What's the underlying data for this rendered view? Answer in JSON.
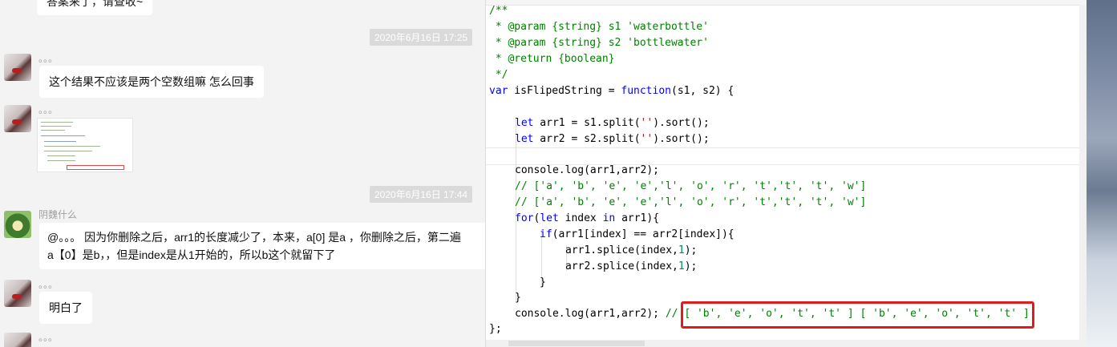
{
  "chat": {
    "top_bubble_partial": "答案来了，请查收~",
    "ts1": "2020年6月16日 17:25",
    "ts2": "2020年6月16日 17:44",
    "dots": "。。。",
    "msg1": "这个结果不应该是两个空数组嘛 怎么回事",
    "nick_yinhei": "阴魏什么",
    "msg2_line1": "@。。。 因为你删除之后，arr1的长度减少了，本来，a[0] 是a ，你删除之后，第二遍",
    "msg2_line2": "a【0】是b，，但是index是从1开始的，所以b这个就留下了",
    "msg3": "明白了"
  },
  "code": {
    "l1": "/**",
    "l2": " * @param {string} s1 'waterbottle'",
    "l3": " * @param {string} s2 'bottlewater'",
    "l4": " * @return {boolean}",
    "l5": " */",
    "l6_kw": "var",
    "l6_mid": " isFlipedString = ",
    "l6_fn": "function",
    "l6_end": "(s1, s2) {",
    "l8_kw": "let",
    "l8_a": " arr1 = s1.split(",
    "l8_s": "''",
    "l8_b": ").sort();",
    "l9_kw": "let",
    "l9_a": " arr2 = s2.split(",
    "l9_s": "''",
    "l9_b": ").sort();",
    "l11": "console.log(arr1,arr2);",
    "l12": "// ['a', 'b', 'e', 'e','l', 'o', 'r', 't','t', 't', 'w']",
    "l13": "// ['a', 'b', 'e', 'e','l', 'o', 'r', 't','t', 't', 'w']",
    "l14_kw": "for",
    "l14_a": "(",
    "l14_kw2": "let",
    "l14_b": " index ",
    "l14_kw3": "in",
    "l14_c": " arr1){",
    "l15_kw": "if",
    "l15_a": "(arr1[index] == arr2[index]){",
    "l16_a": "arr1.splice(index,",
    "l16_n": "1",
    "l16_b": ");",
    "l17_a": "arr2.splice(index,",
    "l17_n": "1",
    "l17_b": ");",
    "l18": "}",
    "l19": "}",
    "l20_a": "console.log(arr1,arr2); ",
    "l20_c": "// [ 'b', 'e', 'o', 't', 't' ] [ 'b', 'e', 'o', 't', 't' ]",
    "l21": "};"
  }
}
